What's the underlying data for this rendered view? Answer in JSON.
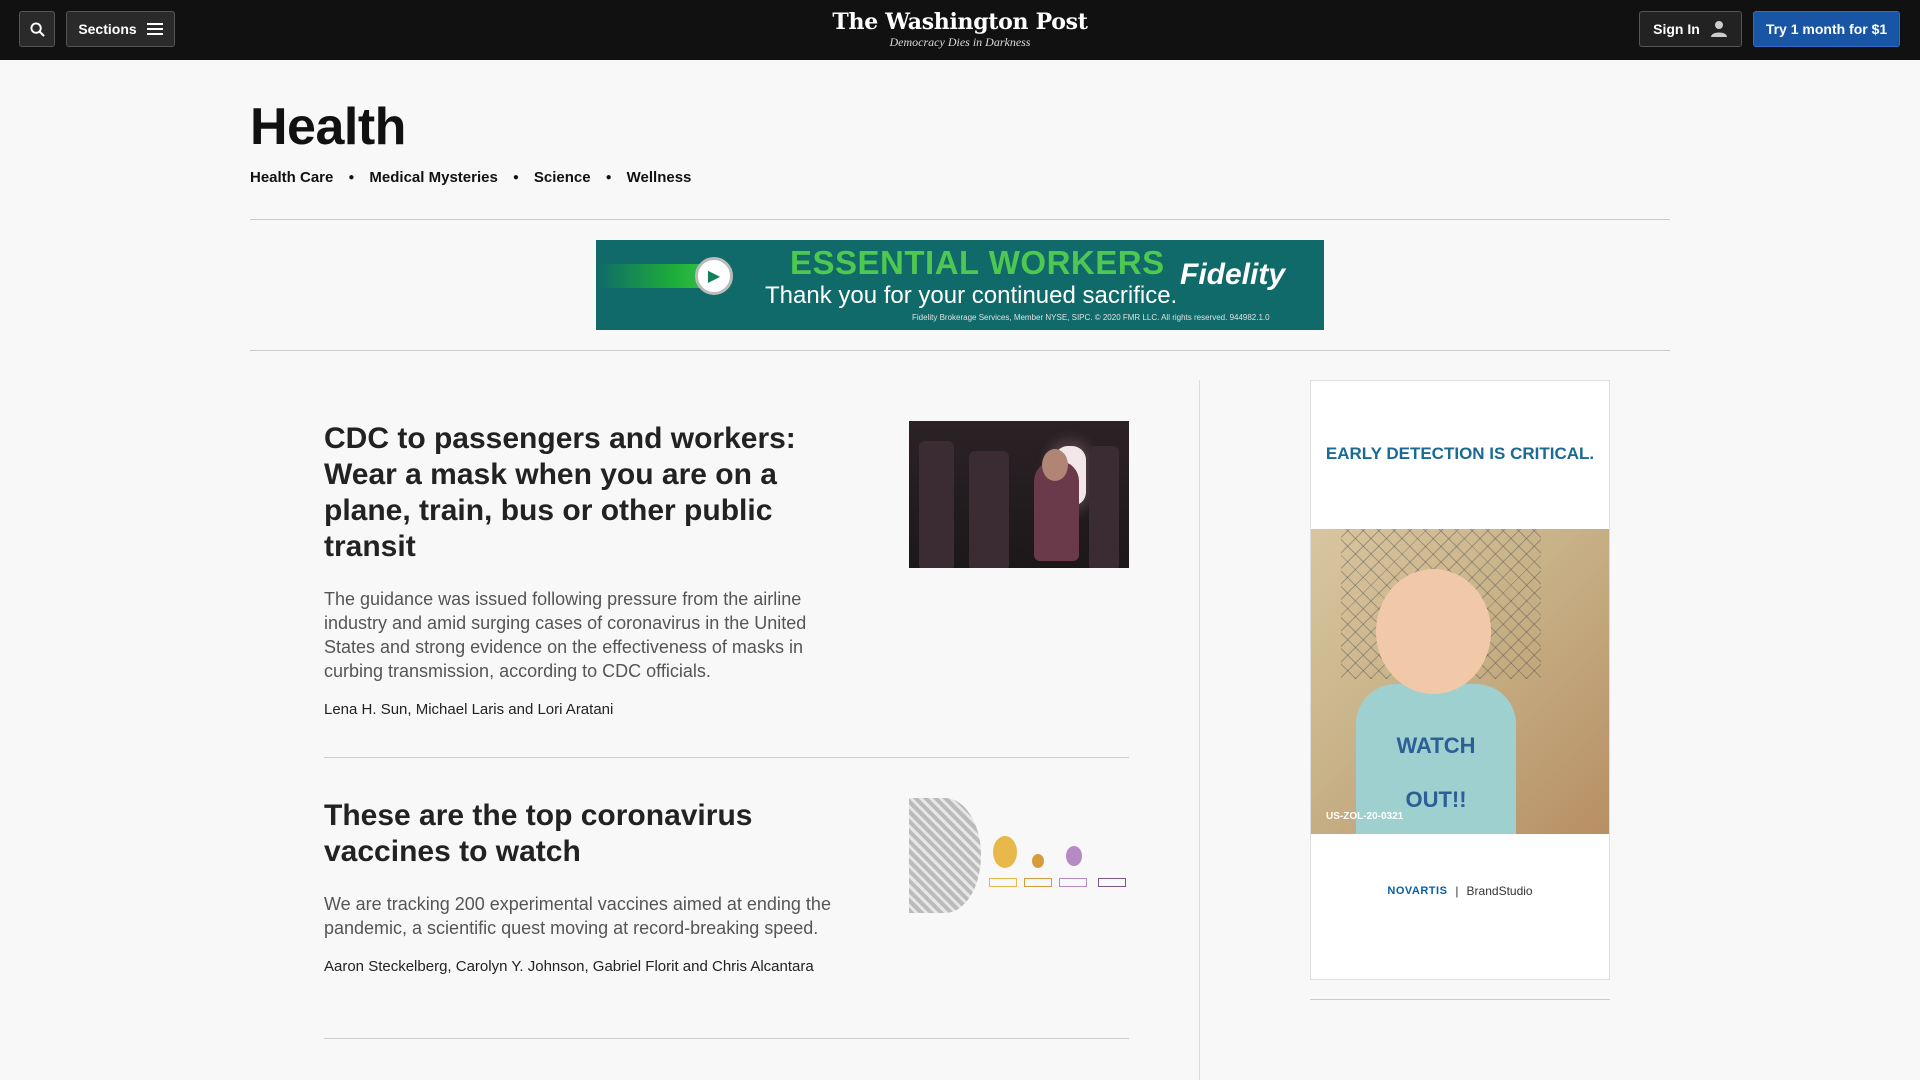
{
  "header": {
    "sections_label": "Sections",
    "logo": "The Washington Post",
    "tagline": "Democracy Dies in Darkness",
    "signin_label": "Sign In",
    "subscribe_label": "Try 1 month for $1"
  },
  "section": {
    "title": "Health",
    "subnav": [
      "Health Care",
      "Medical Mysteries",
      "Science",
      "Wellness"
    ]
  },
  "banner_ad": {
    "headline": "ESSENTIAL WORKERS",
    "subline": "Thank you for your continued sacrifice.",
    "brand": "Fidelity",
    "fine_print": "Fidelity Brokerage Services, Member NYSE, SIPC. © 2020 FMR LLC. All rights reserved. 944982.1.0"
  },
  "stories": [
    {
      "headline": "CDC to passengers and workers: Wear a mask when you are on a plane, train, bus or other public transit",
      "summary": "The guidance was issued following pressure from the airline industry and amid surging cases of coronavirus in the United States and strong evidence on the effectiveness of masks in curbing transmission, according to CDC officials.",
      "byline": "Lena H. Sun, Michael Laris and Lori Aratani"
    },
    {
      "headline": "These are the top coronavirus vaccines to watch",
      "summary": "We are tracking 200 experimental vaccines aimed at ending the pandemic, a scientific quest moving at record-breaking speed.",
      "byline": "Aaron Steckelberg, Carolyn Y. Johnson, Gabriel Florit and Chris Alcantara"
    }
  ],
  "side_ad": {
    "headline": "EARLY DETECTION IS CRITICAL.",
    "shirt_text": "WATCH OUT!!",
    "code": "US-ZOL-20-0321",
    "logo_left": "NOVARTIS",
    "logo_right": "BrandStudio"
  },
  "colors": {
    "topbar": "#111111",
    "subscribe_button": "#1955a5",
    "ad_green": "#4ec850",
    "ad_teal": "#0f6a69",
    "side_ad_blue": "#1a6a94"
  }
}
